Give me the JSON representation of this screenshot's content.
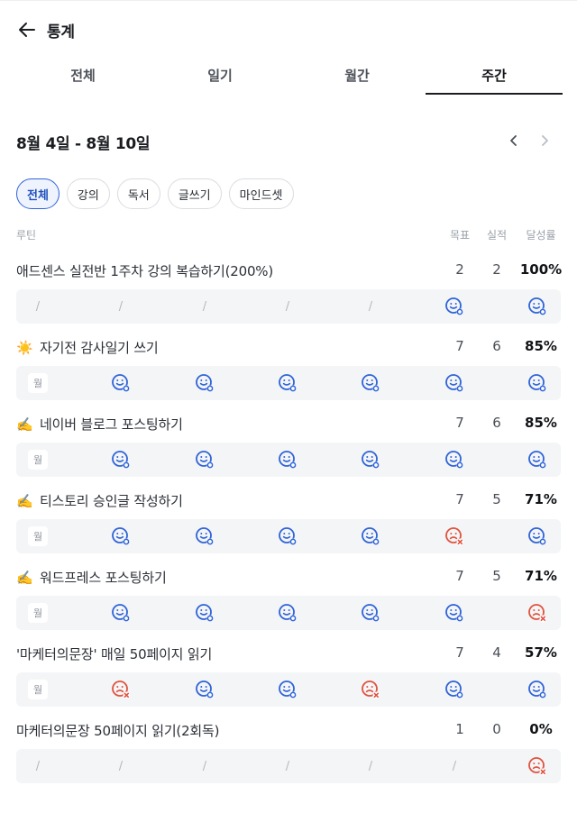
{
  "header": {
    "title": "통계"
  },
  "tabs": [
    {
      "label": "전체",
      "active": false
    },
    {
      "label": "일기",
      "active": false
    },
    {
      "label": "월간",
      "active": false
    },
    {
      "label": "주간",
      "active": true
    }
  ],
  "week": {
    "range": "8월 4일 - 8월 10일"
  },
  "filters": [
    {
      "label": "전체",
      "active": true
    },
    {
      "label": "강의",
      "active": false
    },
    {
      "label": "독서",
      "active": false
    },
    {
      "label": "글쓰기",
      "active": false
    },
    {
      "label": "마인드셋",
      "active": false
    }
  ],
  "columns": {
    "routine": "루틴",
    "goal": "목표",
    "actual": "실적",
    "rate": "달성률"
  },
  "colors": {
    "accent": "#2f64d8",
    "success_icon": "#2f64d8",
    "fail_icon": "#e0533f"
  },
  "day_legend": {
    "none": "/",
    "weekday": "월",
    "done": "smile-check-icon",
    "missed": "sad-x-icon"
  },
  "routines": [
    {
      "emoji": "",
      "name": "애드센스 실전반 1주차 강의 복습하기(200%)",
      "goal": "2",
      "actual": "2",
      "rate": "100%",
      "days": [
        "none",
        "none",
        "none",
        "none",
        "none",
        "done",
        "done"
      ]
    },
    {
      "emoji": "☀️",
      "name": "자기전 감사일기 쓰기",
      "goal": "7",
      "actual": "6",
      "rate": "85%",
      "days": [
        "weekday",
        "done",
        "done",
        "done",
        "done",
        "done",
        "done"
      ]
    },
    {
      "emoji": "✍️",
      "name": "네이버 블로그 포스팅하기",
      "goal": "7",
      "actual": "6",
      "rate": "85%",
      "days": [
        "weekday",
        "done",
        "done",
        "done",
        "done",
        "done",
        "done"
      ]
    },
    {
      "emoji": "✍️",
      "name": "티스토리 승인글 작성하기",
      "goal": "7",
      "actual": "5",
      "rate": "71%",
      "days": [
        "weekday",
        "done",
        "done",
        "done",
        "done",
        "missed",
        "done"
      ]
    },
    {
      "emoji": "✍️",
      "name": "워드프레스 포스팅하기",
      "goal": "7",
      "actual": "5",
      "rate": "71%",
      "days": [
        "weekday",
        "done",
        "done",
        "done",
        "done",
        "done",
        "missed"
      ]
    },
    {
      "emoji": "",
      "name": "'마케터의문장' 매일 50페이지 읽기",
      "goal": "7",
      "actual": "4",
      "rate": "57%",
      "days": [
        "weekday",
        "missed",
        "done",
        "done",
        "missed",
        "done",
        "done"
      ]
    },
    {
      "emoji": "",
      "name": "마케터의문장 50페이지 읽기(2회독)",
      "goal": "1",
      "actual": "0",
      "rate": "0%",
      "days": [
        "none",
        "none",
        "none",
        "none",
        "none",
        "none",
        "missed"
      ]
    }
  ]
}
